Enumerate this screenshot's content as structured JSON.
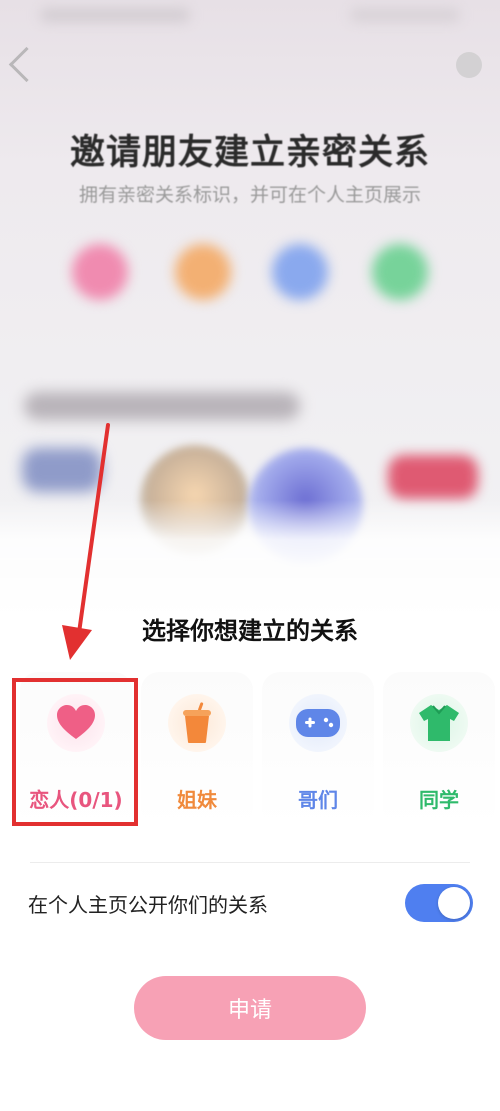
{
  "background": {
    "title": "邀请朋友建立亲密关系",
    "subtitle": "拥有亲密关系标识，并可在个人主页展示"
  },
  "sheet": {
    "title": "选择你想建立的关系",
    "relations": [
      {
        "label": "恋人(0/1)",
        "icon": "heart-icon",
        "color": "#e8557e"
      },
      {
        "label": "姐妹",
        "icon": "cup-icon",
        "color": "#f08a3c"
      },
      {
        "label": "哥们",
        "icon": "gamepad-icon",
        "color": "#5f86e8"
      },
      {
        "label": "同学",
        "icon": "tshirt-icon",
        "color": "#2fba6b"
      }
    ],
    "toggle": {
      "label": "在个人主页公开你们的关系",
      "on": true,
      "color": "#4f7ff0"
    },
    "apply_label": "申请",
    "apply_color": "#f7a1b5"
  },
  "annotation": {
    "color": "#e23030"
  }
}
